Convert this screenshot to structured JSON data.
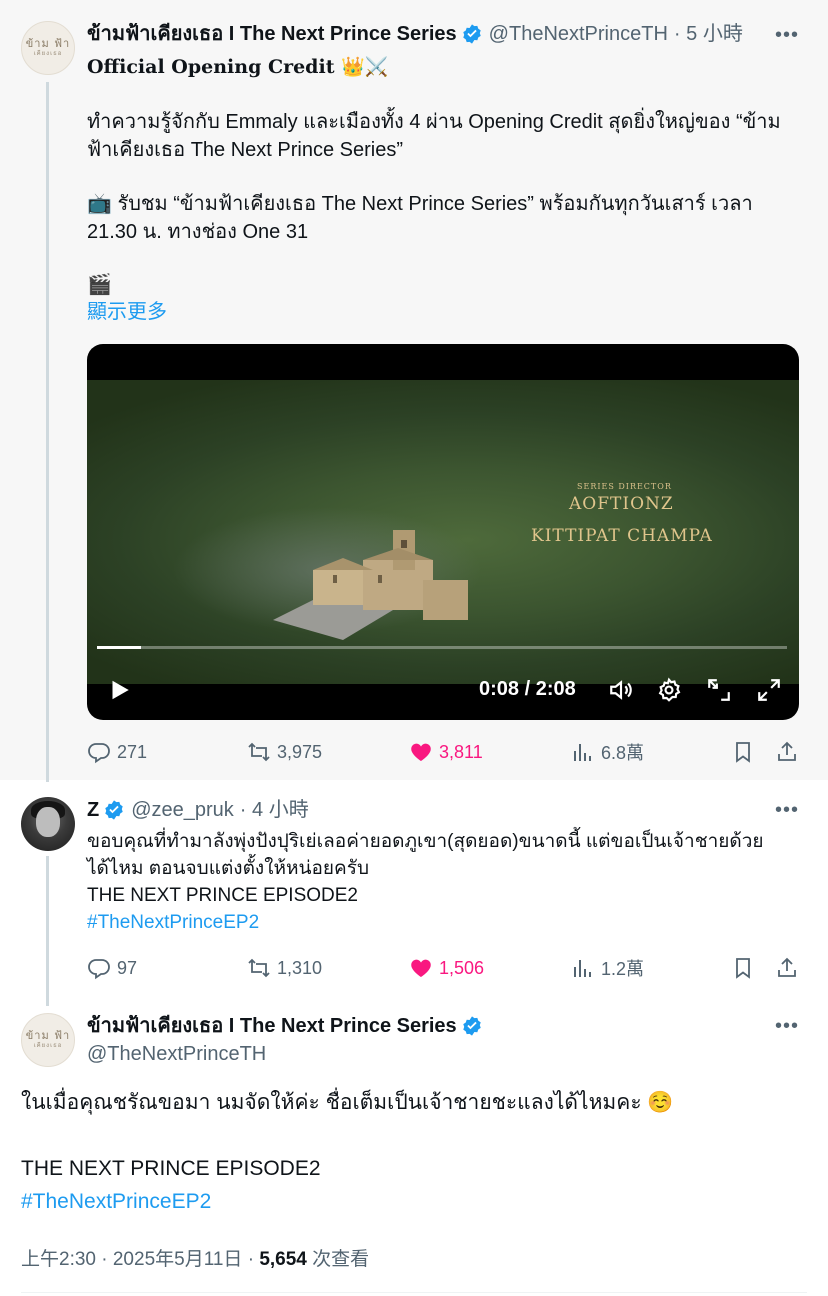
{
  "tweet1": {
    "author_name": "ข้ามฟ้าเคียงเธอ I The Next Prince Series",
    "author_handle": "@TheNextPrinceTH",
    "time": "· 5 小時",
    "avatar_text_line1": "ข้าม ฟ้า",
    "avatar_text_line2": "เคียงเธอ",
    "title_line": "Official Opening Credit 👑⚔️",
    "para1": "ทำความรู้จักกับ Emmaly และเมืองทั้ง 4 ผ่าน Opening Credit สุดยิ่งใหญ่ของ “ข้ามฟ้าเคียงเธอ The Next Prince Series”",
    "para2": "📺 รับชม “ข้ามฟ้าเคียงเธอ The Next Prince Series” พร้อมกันทุกวันเสาร์ เวลา 21.30 น. ทางช่อง One 31",
    "clapper": "🎬",
    "show_more": "顯示更多",
    "video": {
      "credit_small": "SERIES DIRECTOR",
      "credit_line1": "AOFTIONZ",
      "credit_line2": "KITTIPAT CHAMPA",
      "time_readout": "0:08 / 2:08",
      "progress": 0.064
    },
    "stats": {
      "replies": "271",
      "reposts": "3,975",
      "likes": "3,811",
      "views": "6.8萬"
    }
  },
  "tweet2": {
    "author_name": "Z",
    "author_handle": "@zee_pruk",
    "time": "· 4 小時",
    "line1": "ขอบคุณที่ทำมาลังพุ่งปังปุริเย่เลอค่ายอดภูเขา(สุดยอด)ขนาดนี้ แต่ขอเป็นเจ้าชายด้วย",
    "line2": "ได้ไหม ตอนจบแต่งตั้งให้หน่อยครับ",
    "line3": "THE NEXT PRINCE EPISODE2",
    "hashtag": "#TheNextPrinceEP2",
    "stats": {
      "replies": "97",
      "reposts": "1,310",
      "likes": "1,506",
      "views": "1.2萬"
    }
  },
  "tweet3": {
    "author_name": "ข้ามฟ้าเคียงเธอ I The Next Prince Series",
    "author_handle": "@TheNextPrinceTH",
    "line1": "ในเมื่อคุณชรัณขอมา นมจัดให้ค่ะ ชื่อเต็มเป็นเจ้าชายชะแลงได้ไหมคะ ☺️",
    "line2": "THE NEXT PRINCE EPISODE2",
    "hashtag": "#TheNextPrinceEP2",
    "timestamp": "上午2:30 · 2025年5月11日 · ",
    "views_count": "5,654",
    "views_label": " 次查看"
  },
  "colors": {
    "link": "#1d9bf0",
    "like": "#f91880",
    "muted": "#536471",
    "verified": "#1d9bf0"
  },
  "icons": [
    "verified-badge-icon",
    "more-icon",
    "reply-icon",
    "repost-icon",
    "like-icon",
    "views-icon",
    "bookmark-icon",
    "share-icon",
    "play-icon",
    "volume-icon",
    "settings-icon",
    "pip-icon",
    "fullscreen-icon"
  ]
}
